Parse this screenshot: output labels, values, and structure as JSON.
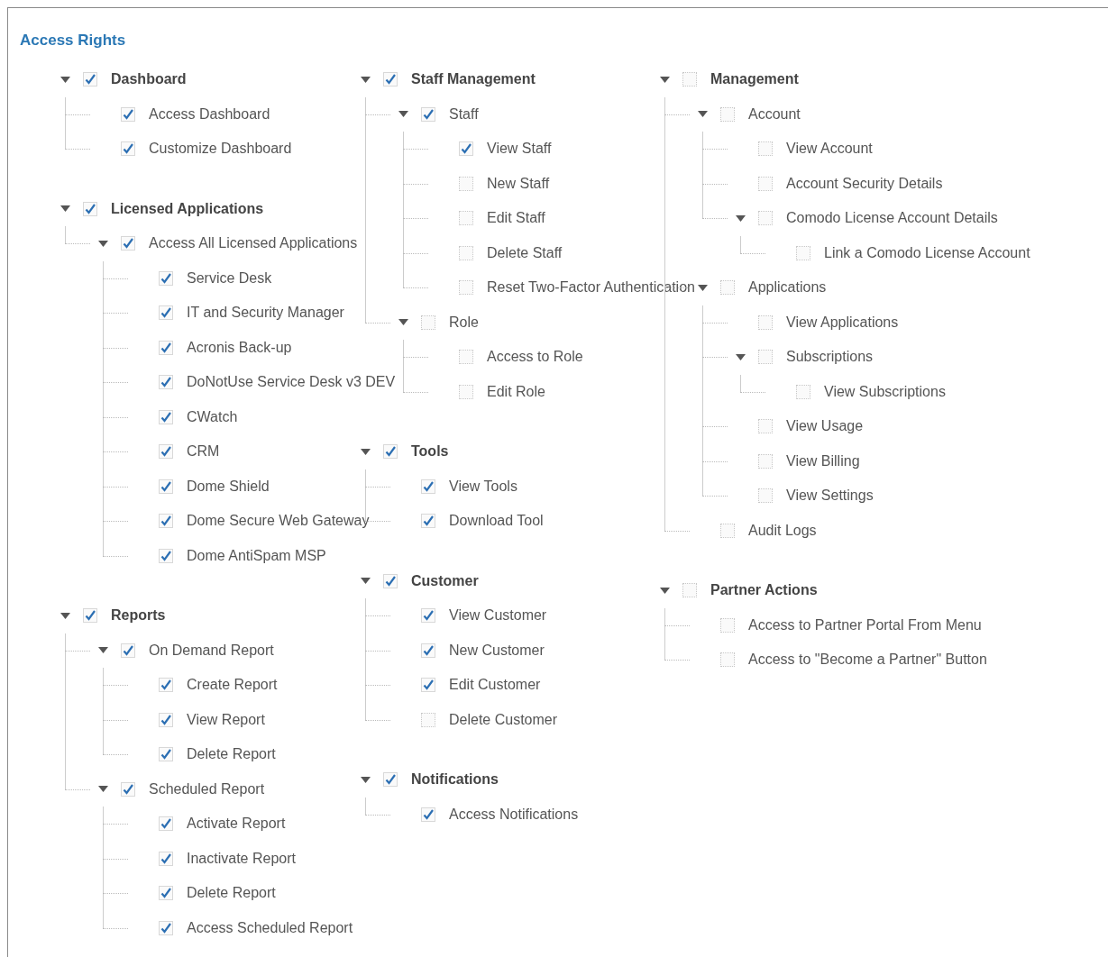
{
  "title": "Access Rights",
  "columns": [
    {
      "groups": [
        {
          "label": "Dashboard",
          "checked": true,
          "expanded": true,
          "children": [
            {
              "label": "Access Dashboard",
              "checked": true
            },
            {
              "label": "Customize Dashboard",
              "checked": true
            }
          ]
        },
        {
          "label": "Licensed Applications",
          "checked": true,
          "expanded": true,
          "children": [
            {
              "label": "Access All Licensed Applications",
              "checked": true,
              "expanded": true,
              "children": [
                {
                  "label": "Service Desk",
                  "checked": true
                },
                {
                  "label": "IT and Security Manager",
                  "checked": true
                },
                {
                  "label": "Acronis Back-up",
                  "checked": true
                },
                {
                  "label": "DoNotUse Service Desk v3 DEV",
                  "checked": true
                },
                {
                  "label": "CWatch",
                  "checked": true
                },
                {
                  "label": "CRM",
                  "checked": true
                },
                {
                  "label": "Dome Shield",
                  "checked": true
                },
                {
                  "label": "Dome Secure Web Gateway",
                  "checked": true
                },
                {
                  "label": "Dome AntiSpam MSP",
                  "checked": true
                }
              ]
            }
          ]
        },
        {
          "label": "Reports",
          "checked": true,
          "expanded": true,
          "children": [
            {
              "label": "On Demand Report",
              "checked": true,
              "expanded": true,
              "children": [
                {
                  "label": "Create Report",
                  "checked": true
                },
                {
                  "label": "View Report",
                  "checked": true
                },
                {
                  "label": "Delete Report",
                  "checked": true
                }
              ]
            },
            {
              "label": "Scheduled Report",
              "checked": true,
              "expanded": true,
              "children": [
                {
                  "label": "Activate Report",
                  "checked": true
                },
                {
                  "label": "Inactivate Report",
                  "checked": true
                },
                {
                  "label": "Delete Report",
                  "checked": true
                },
                {
                  "label": "Access Scheduled Report",
                  "checked": true
                }
              ]
            }
          ]
        }
      ]
    },
    {
      "groups": [
        {
          "label": "Staff Management",
          "checked": true,
          "expanded": true,
          "children": [
            {
              "label": "Staff",
              "checked": true,
              "expanded": true,
              "children": [
                {
                  "label": "View Staff",
                  "checked": true
                },
                {
                  "label": "New Staff",
                  "checked": false
                },
                {
                  "label": "Edit Staff",
                  "checked": false
                },
                {
                  "label": "Delete Staff",
                  "checked": false
                },
                {
                  "label": "Reset Two-Factor Authentication",
                  "checked": false
                }
              ]
            },
            {
              "label": "Role",
              "checked": false,
              "expanded": true,
              "children": [
                {
                  "label": "Access to Role",
                  "checked": false
                },
                {
                  "label": "Edit Role",
                  "checked": false
                }
              ]
            }
          ]
        },
        {
          "label": "Tools",
          "checked": true,
          "expanded": true,
          "children": [
            {
              "label": "View Tools",
              "checked": true
            },
            {
              "label": "Download Tool",
              "checked": true
            }
          ]
        },
        {
          "label": "Customer",
          "checked": true,
          "expanded": true,
          "children": [
            {
              "label": "View Customer",
              "checked": true
            },
            {
              "label": "New Customer",
              "checked": true
            },
            {
              "label": "Edit Customer",
              "checked": true
            },
            {
              "label": "Delete Customer",
              "checked": false
            }
          ]
        },
        {
          "label": "Notifications",
          "checked": true,
          "expanded": true,
          "children": [
            {
              "label": "Access Notifications",
              "checked": true
            }
          ]
        }
      ]
    },
    {
      "groups": [
        {
          "label": "Management",
          "checked": false,
          "expanded": true,
          "children": [
            {
              "label": "Account",
              "checked": false,
              "expanded": true,
              "children": [
                {
                  "label": "View Account",
                  "checked": false
                },
                {
                  "label": "Account Security Details",
                  "checked": false
                },
                {
                  "label": "Comodo License Account Details",
                  "checked": false,
                  "expanded": true,
                  "children": [
                    {
                      "label": "Link a Comodo License Account",
                      "checked": false
                    }
                  ]
                }
              ]
            },
            {
              "label": "Applications",
              "checked": false,
              "expanded": true,
              "children": [
                {
                  "label": "View Applications",
                  "checked": false
                },
                {
                  "label": "Subscriptions",
                  "checked": false,
                  "expanded": true,
                  "children": [
                    {
                      "label": "View Subscriptions",
                      "checked": false
                    }
                  ]
                },
                {
                  "label": "View Usage",
                  "checked": false
                },
                {
                  "label": "View Billing",
                  "checked": false
                },
                {
                  "label": "View Settings",
                  "checked": false
                }
              ]
            },
            {
              "label": "Audit Logs",
              "checked": false
            }
          ]
        },
        {
          "label": "Partner Actions",
          "checked": false,
          "expanded": true,
          "children": [
            {
              "label": "Access to Partner Portal From Menu",
              "checked": false
            },
            {
              "label": "Access to \"Become a Partner\" Button",
              "checked": false
            }
          ]
        }
      ]
    }
  ]
}
